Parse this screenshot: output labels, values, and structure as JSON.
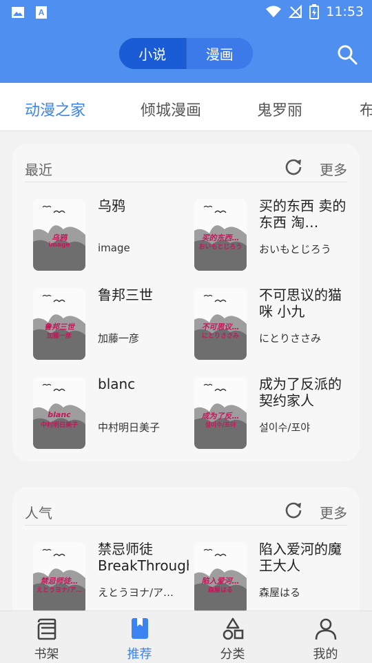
{
  "status_bar": {
    "time": "11:53"
  },
  "header": {
    "segments": [
      "小说",
      "漫画"
    ],
    "active_segment": "小说"
  },
  "tabs": [
    "动漫之家",
    "倾城漫画",
    "鬼罗丽",
    "布"
  ],
  "recent": {
    "title": "最近",
    "more": "更多",
    "books": [
      {
        "title": "乌鸦",
        "author": "image",
        "cover_title": "乌鸦",
        "cover_author": "image"
      },
      {
        "title": "买的东西 卖的东西 淘…",
        "author": "おいもとじろう",
        "cover_title": "买的东西…",
        "cover_author": "おいもとじろう"
      },
      {
        "title": "鲁邦三世",
        "author": "加藤一彦",
        "cover_title": "鲁邦三世",
        "cover_author": "加藤一彦"
      },
      {
        "title": "不可思议的猫咪 小九",
        "author": "にとりささみ",
        "cover_title": "不可思议…",
        "cover_author": "にとりささみ"
      },
      {
        "title": "blanc",
        "author": "中村明日美子",
        "cover_title": "blanc",
        "cover_author": "中村明日美子"
      },
      {
        "title": "成为了反派的契约家人",
        "author": "설이수/포야",
        "cover_title": "成为了反…",
        "cover_author": "설이수/포야"
      }
    ]
  },
  "popular": {
    "title": "人气",
    "more": "更多",
    "books": [
      {
        "title": "禁忌师徒BreakThrough",
        "author": "えとうヨナ/ア…",
        "cover_title": "禁忌师徒…",
        "cover_author": "えとうヨナ/ア…"
      },
      {
        "title": "陷入爱河的魔王大人",
        "author": "森屋はる",
        "cover_title": "陷入爱河…",
        "cover_author": "森屋はる"
      }
    ]
  },
  "bottom_nav": [
    {
      "label": "书架",
      "icon": "bookshelf-icon"
    },
    {
      "label": "推荐",
      "icon": "bookmark-book-icon"
    },
    {
      "label": "分类",
      "icon": "category-shapes-icon"
    },
    {
      "label": "我的",
      "icon": "person-icon"
    }
  ],
  "active_nav": "推荐",
  "colors": {
    "primary": "#4f8ff0",
    "accent": "#3a83f1",
    "segment_active": "#1a5bd6",
    "cover_text": "#c0185a"
  }
}
